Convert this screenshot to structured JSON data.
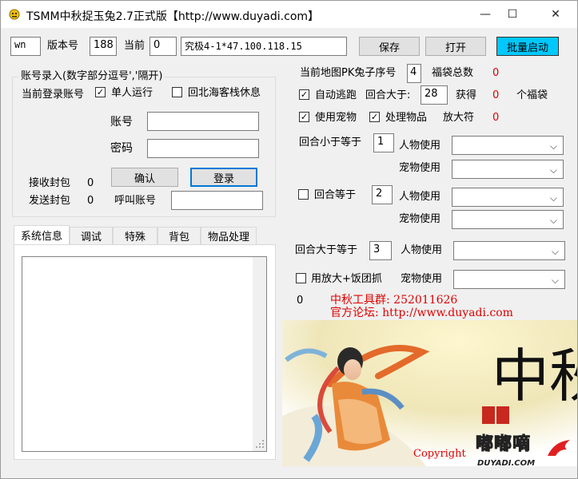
{
  "window": {
    "title": "TSMM中秋捉玉兔2.7正式版【http://www.duyadi.com】",
    "minimize": "—",
    "maximize": "☐",
    "close": "✕"
  },
  "top": {
    "wn_value": "wn",
    "version_label": "版本号",
    "version_value": "188",
    "current_label": "当前",
    "current_value": "0",
    "server_value": "究极4-1*47.100.118.15",
    "save_label": "保存",
    "open_label": "打开",
    "batch_label": "批量启动"
  },
  "account": {
    "group_title": "账号录入(数字部分逗号','隔开)",
    "current_login_label": "当前登录账号",
    "single_run_label": "单人运行",
    "single_run_checked": true,
    "return_label": "回北海客栈休息",
    "return_checked": false,
    "account_label": "账号",
    "account_value": "",
    "password_label": "密码",
    "password_value": "",
    "recv_label": "接收封包",
    "recv_value": "0",
    "send_label": "发送封包",
    "send_value": "0",
    "confirm_label": "确认",
    "login_label": "登录",
    "call_label": "呼叫账号",
    "call_value": ""
  },
  "tabs": [
    "系统信息",
    "调试",
    "特殊",
    "背包",
    "物品处理"
  ],
  "right": {
    "pk_label": "当前地图PK兔子序号",
    "pk_value": "4",
    "bag_total_label": "福袋总数",
    "bag_total_value": "0",
    "auto_escape_label": "自动逃跑",
    "auto_escape_checked": true,
    "round_gt_label": "回合大于:",
    "round_gt_value": "28",
    "gain_label": "获得",
    "gain_value": "0",
    "bags_unit": "个福袋",
    "use_pet_label": "使用宠物",
    "use_pet_checked": true,
    "process_items_label": "处理物品",
    "process_items_checked": true,
    "magnifier_label": "放大符",
    "magnifier_value": "0",
    "round_le_label": "回合小于等于",
    "round_le_value": "1",
    "char_use_label": "人物使用",
    "pet_use_label": "宠物使用",
    "round_eq_label": "回合等于",
    "round_eq_checked": false,
    "round_eq_value": "2",
    "round_ge_label": "回合大于等于",
    "round_ge_value": "3",
    "magnify_catch_label": "用放大+饭团抓",
    "magnify_catch_checked": false,
    "counter_value": "0",
    "qq_group_label": "中秋工具群: 252011626",
    "forum_label": "官方论坛: http://www.duyadi.com",
    "copyright_label": "Copyright",
    "watermark_text": "嘟嘟嘀",
    "watermark_url": "DUYADI.COM",
    "calligraphy_text": "中秋"
  },
  "colors": {
    "accent_blue": "#0078d7",
    "batch_button": "#00c8ff",
    "red_text": "#e00000"
  }
}
